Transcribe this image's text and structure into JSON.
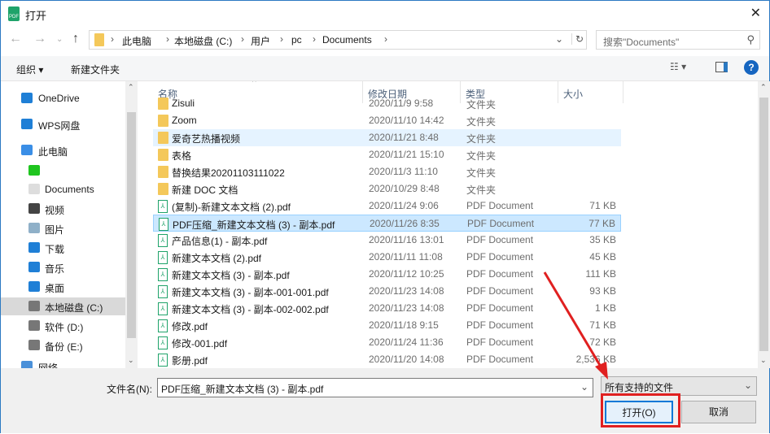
{
  "title": "打开",
  "address": {
    "crumbs": [
      "此电脑",
      "本地磁盘 (C:)",
      "用户",
      "pc",
      "Documents"
    ]
  },
  "search": {
    "placeholder": "搜索\"Documents\""
  },
  "toolbar": {
    "organize": "组织 ▾",
    "new_folder": "新建文件夹"
  },
  "nav": [
    {
      "label": "OneDrive",
      "icon": "cloud-icon"
    },
    {
      "label": "WPS网盘",
      "icon": "cloud-icon"
    },
    {
      "label": "此电脑",
      "icon": "computer-icon"
    },
    {
      "label": "",
      "icon": "iqiyi-icon"
    },
    {
      "label": "Documents",
      "icon": "document-icon"
    },
    {
      "label": "视频",
      "icon": "video-icon"
    },
    {
      "label": "图片",
      "icon": "picture-icon"
    },
    {
      "label": "下载",
      "icon": "download-icon"
    },
    {
      "label": "音乐",
      "icon": "music-icon"
    },
    {
      "label": "桌面",
      "icon": "desktop-icon"
    },
    {
      "label": "本地磁盘 (C:)",
      "icon": "drive-icon"
    },
    {
      "label": "软件 (D:)",
      "icon": "drive-icon"
    },
    {
      "label": "备份 (E:)",
      "icon": "drive-icon"
    },
    {
      "label": "网络",
      "icon": "network-icon"
    }
  ],
  "columns": [
    "名称",
    "修改日期",
    "类型",
    "大小"
  ],
  "files": [
    {
      "name": "Zisuli",
      "date": "2020/11/9 9:58",
      "type": "文件夹",
      "size": "",
      "kind": "folder"
    },
    {
      "name": "Zoom",
      "date": "2020/11/10 14:42",
      "type": "文件夹",
      "size": "",
      "kind": "folder"
    },
    {
      "name": "爱奇艺热播视频",
      "date": "2020/11/21 8:48",
      "type": "文件夹",
      "size": "",
      "kind": "folder"
    },
    {
      "name": "表格",
      "date": "2020/11/21 15:10",
      "type": "文件夹",
      "size": "",
      "kind": "folder"
    },
    {
      "name": "替换结果20201103111022",
      "date": "2020/11/3 11:10",
      "type": "文件夹",
      "size": "",
      "kind": "folder"
    },
    {
      "name": "新建 DOC 文档",
      "date": "2020/10/29 8:48",
      "type": "文件夹",
      "size": "",
      "kind": "folder"
    },
    {
      "name": "(复制)-新建文本文档 (2).pdf",
      "date": "2020/11/24 9:06",
      "type": "PDF Document",
      "size": "71 KB",
      "kind": "pdf"
    },
    {
      "name": "PDF压缩_新建文本文档 (3) - 副本.pdf",
      "date": "2020/11/26 8:35",
      "type": "PDF Document",
      "size": "77 KB",
      "kind": "pdf"
    },
    {
      "name": "产品信息(1) - 副本.pdf",
      "date": "2020/11/16 13:01",
      "type": "PDF Document",
      "size": "35 KB",
      "kind": "pdf"
    },
    {
      "name": "新建文本文档 (2).pdf",
      "date": "2020/11/11 11:08",
      "type": "PDF Document",
      "size": "45 KB",
      "kind": "pdf"
    },
    {
      "name": "新建文本文档 (3) - 副本.pdf",
      "date": "2020/11/12 10:25",
      "type": "PDF Document",
      "size": "111 KB",
      "kind": "pdf"
    },
    {
      "name": "新建文本文档 (3) - 副本-001-001.pdf",
      "date": "2020/11/23 14:08",
      "type": "PDF Document",
      "size": "93 KB",
      "kind": "pdf"
    },
    {
      "name": "新建文本文档 (3) - 副本-002-002.pdf",
      "date": "2020/11/23 14:08",
      "type": "PDF Document",
      "size": "1 KB",
      "kind": "pdf"
    },
    {
      "name": "修改.pdf",
      "date": "2020/11/18 9:15",
      "type": "PDF Document",
      "size": "71 KB",
      "kind": "pdf"
    },
    {
      "name": "修改-001.pdf",
      "date": "2020/11/24 11:36",
      "type": "PDF Document",
      "size": "72 KB",
      "kind": "pdf"
    },
    {
      "name": "影册.pdf",
      "date": "2020/11/20 14:08",
      "type": "PDF Document",
      "size": "2,536 KB",
      "kind": "pdf"
    }
  ],
  "bottom": {
    "filename_label": "文件名(N):",
    "filename_value": "PDF压缩_新建文本文档 (3) - 副本.pdf",
    "filetype": "所有支持的文件",
    "open": "打开(O)",
    "cancel": "取消"
  },
  "colors": {
    "highlight": "#e02020",
    "selected": "#cce8ff",
    "accent": "#0078d7"
  }
}
